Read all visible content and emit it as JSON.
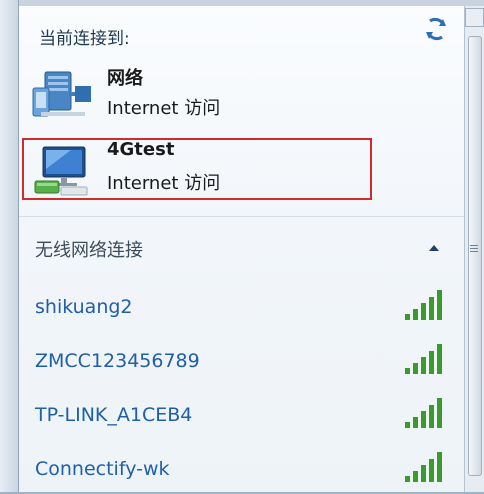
{
  "header": {
    "title": "当前连接到:",
    "refresh_icon": "refresh-icon"
  },
  "connections": [
    {
      "name": "网络",
      "status": "Internet 访问",
      "icon": "wired-network-icon"
    },
    {
      "name": "4Gtest",
      "status": "Internet 访问",
      "icon": "wireless-computer-icon",
      "highlighted": true
    }
  ],
  "wireless": {
    "title": "无线网络连接",
    "collapse_icon": "chevron-up-icon",
    "networks": [
      {
        "ssid": "shikuang2",
        "signal_bars": 5
      },
      {
        "ssid": "ZMCC123456789",
        "signal_bars": 5
      },
      {
        "ssid": "TP-LINK_A1CEB4",
        "signal_bars": 5
      },
      {
        "ssid": "Connectify-wk",
        "signal_bars": 5
      }
    ]
  },
  "colors": {
    "ssid_text": "#1e5fa8",
    "signal_green": "#3b9a2c",
    "highlight_border": "#d22b2b"
  }
}
